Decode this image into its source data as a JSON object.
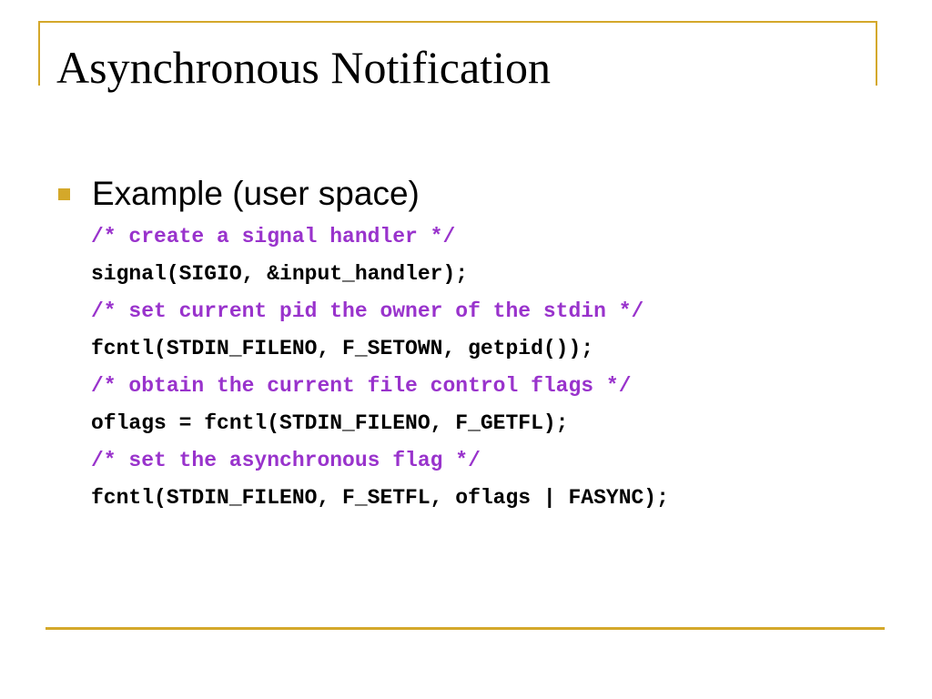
{
  "slide": {
    "title": "Asynchronous Notification",
    "bullet": "Example (user space)",
    "code_lines": [
      {
        "kind": "comment",
        "text": "/* create a signal handler */"
      },
      {
        "kind": "code",
        "text": "signal(SIGIO, &input_handler);"
      },
      {
        "kind": "comment",
        "text": "/* set current pid the owner of the stdin */"
      },
      {
        "kind": "code",
        "text": "fcntl(STDIN_FILENO, F_SETOWN, getpid());"
      },
      {
        "kind": "comment",
        "text": "/* obtain the current file control flags */"
      },
      {
        "kind": "code",
        "text": "oflags = fcntl(STDIN_FILENO, F_GETFL);"
      },
      {
        "kind": "comment",
        "text": "/* set the asynchronous flag */"
      },
      {
        "kind": "code",
        "text": "fcntl(STDIN_FILENO, F_SETFL, oflags | FASYNC);"
      }
    ]
  },
  "colors": {
    "accent": "#d4a82a",
    "comment": "#9933cc",
    "text": "#000000"
  },
  "icons": {
    "bullet": "square-bullet-icon"
  }
}
